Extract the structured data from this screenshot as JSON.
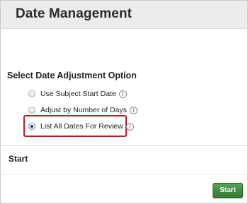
{
  "header": {
    "title": "Date Management"
  },
  "adjustment": {
    "section_title": "Select Date Adjustment Option",
    "options": [
      {
        "label": "Use Subject Start Date",
        "selected": false,
        "info_icon": "info-icon"
      },
      {
        "label": "Adjust by Number of Days",
        "selected": false,
        "info_icon": "info-icon"
      },
      {
        "label": "List All Dates For Review",
        "selected": true,
        "info_icon": "info-icon"
      }
    ],
    "highlight_color": "#b3222a"
  },
  "start_section": {
    "heading": "Start",
    "button_label": "Start",
    "button_color": "#2f7a30"
  }
}
